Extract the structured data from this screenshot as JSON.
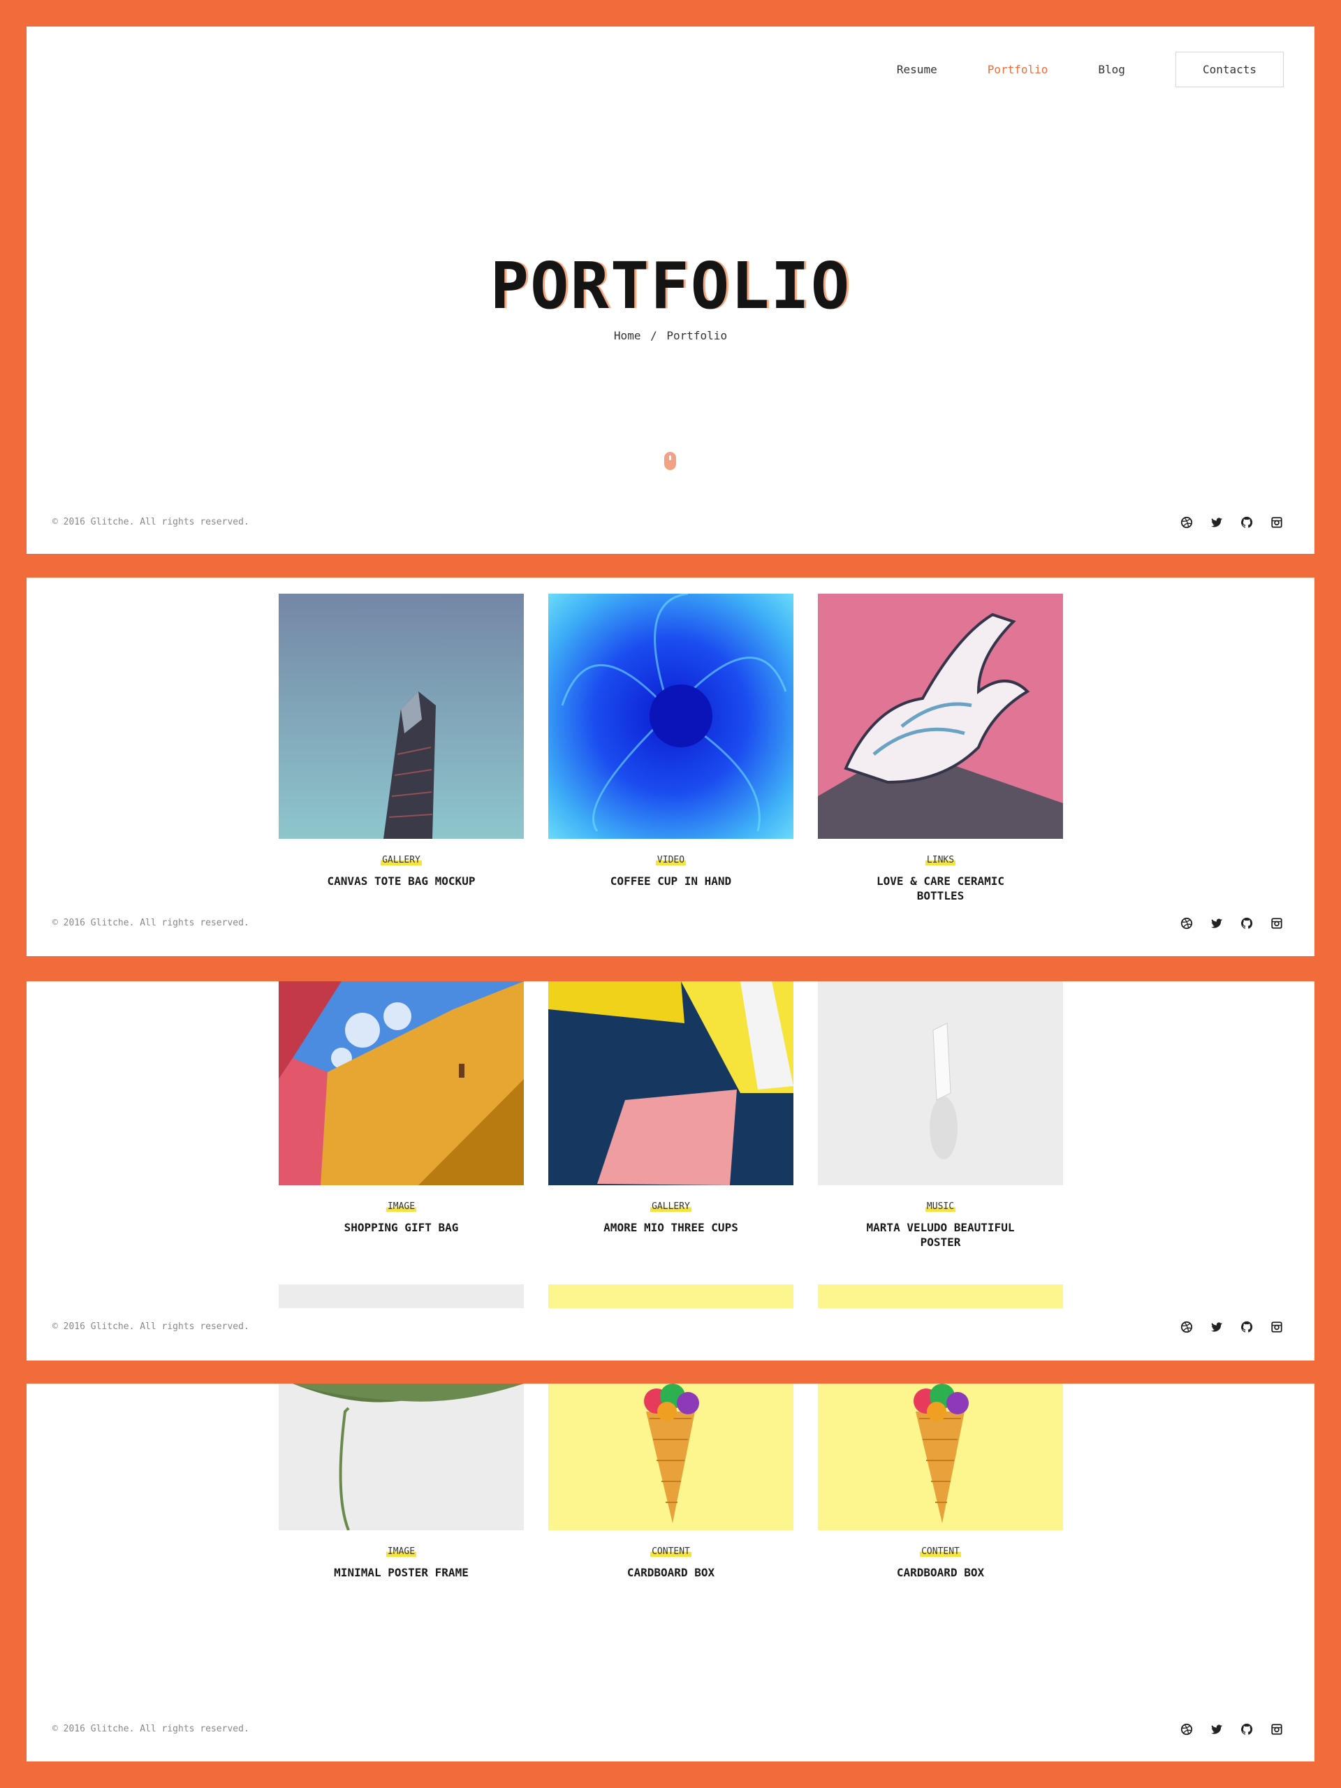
{
  "nav": {
    "items": [
      {
        "label": "Resume"
      },
      {
        "label": "Portfolio"
      },
      {
        "label": "Blog"
      }
    ],
    "contacts_label": "Contacts"
  },
  "hero": {
    "title": "PORTFOLIO",
    "breadcrumb": {
      "home": "Home",
      "separator": "/",
      "current": "Portfolio"
    }
  },
  "footer": {
    "copyright": "© 2016 Glitche. All rights reserved.",
    "socials": [
      "dribbble-icon",
      "twitter-icon",
      "github-icon",
      "instagram-icon"
    ]
  },
  "portfolio": [
    {
      "tag": "GALLERY",
      "title": "CANVAS TOTE BAG MOCKUP"
    },
    {
      "tag": "VIDEO",
      "title": "COFFEE CUP IN HAND"
    },
    {
      "tag": "LINKS",
      "title": "LOVE & CARE CERAMIC BOTTLES"
    },
    {
      "tag": "IMAGE",
      "title": "SHOPPING GIFT BAG"
    },
    {
      "tag": "GALLERY",
      "title": "AMORE MIO THREE CUPS"
    },
    {
      "tag": "MUSIC",
      "title": "MARTA VELUDO BEAUTIFUL POSTER"
    },
    {
      "tag": "IMAGE",
      "title": "MINIMAL POSTER FRAME"
    },
    {
      "tag": "CONTENT",
      "title": "CARDBOARD BOX"
    },
    {
      "tag": "CONTENT",
      "title": "CARDBOARD BOX"
    }
  ],
  "colors": {
    "accent": "#f26b3a",
    "tag_highlight": "#f6e33b"
  }
}
